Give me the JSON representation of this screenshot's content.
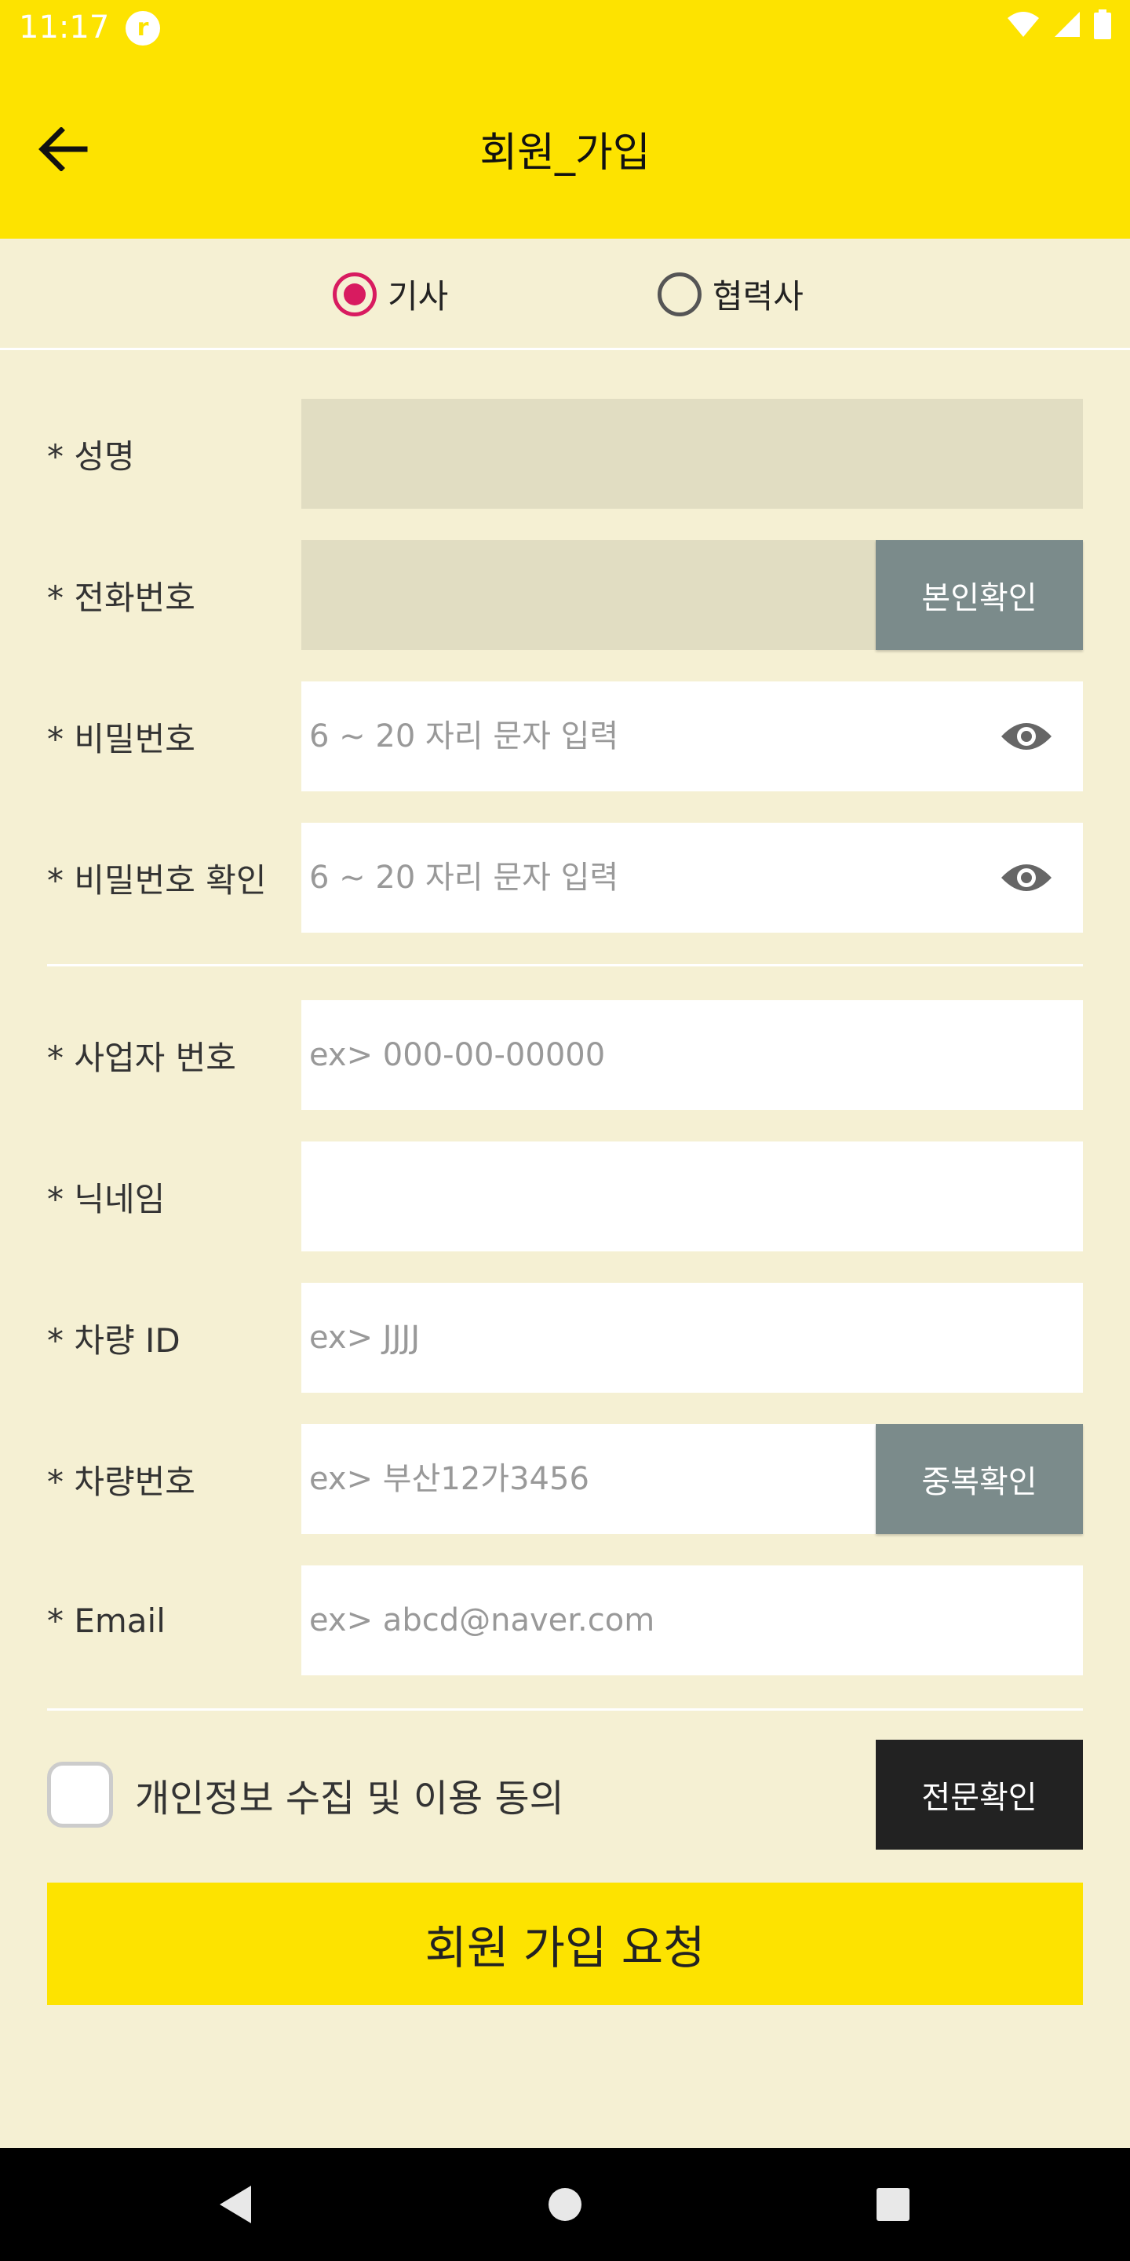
{
  "status_bar": {
    "time": "11:17",
    "app_icon_glyph": "r"
  },
  "app_bar": {
    "title": "회원_가입"
  },
  "member_type": {
    "options": [
      {
        "label": "기사",
        "selected": true
      },
      {
        "label": "협력사",
        "selected": false
      }
    ]
  },
  "fields": {
    "name": {
      "label": "* 성명",
      "value": "",
      "placeholder": ""
    },
    "phone": {
      "label": "* 전화번호",
      "value": "",
      "placeholder": "",
      "button": "본인확인"
    },
    "password": {
      "label": "* 비밀번호",
      "placeholder": "6 ~ 20 자리 문자 입력"
    },
    "password_confirm": {
      "label": "* 비밀번호 확인",
      "placeholder": "6 ~ 20 자리 문자 입력"
    },
    "business_number": {
      "label": "* 사업자 번호",
      "placeholder": "ex> 000-00-00000"
    },
    "nickname": {
      "label": "* 닉네임",
      "placeholder": ""
    },
    "vehicle_id": {
      "label": "* 차량 ID",
      "placeholder": "ex> JJJJ"
    },
    "vehicle_number": {
      "label": "* 차량번호",
      "placeholder": "ex> 부산12가3456",
      "button": "중복확인"
    },
    "email": {
      "label": "* Email",
      "placeholder": "ex> abcd@naver.com"
    }
  },
  "consent": {
    "label": "개인정보 수집 및 이용 동의",
    "checked": false,
    "button": "전문확인"
  },
  "submit": {
    "label": "회원 가입 요청"
  },
  "colors": {
    "brand_yellow": "#fde300",
    "background": "#f5f0d3",
    "disabled_field": "#e1ddc2",
    "radio_accent": "#d81b60",
    "side_button": "#7b8b8b",
    "dark_button": "#222222"
  },
  "icons": {
    "back": "arrow-left-icon",
    "password_toggle": "eye-icon",
    "nav_back": "triangle-back-icon",
    "nav_home": "circle-home-icon",
    "nav_recents": "square-recents-icon"
  }
}
